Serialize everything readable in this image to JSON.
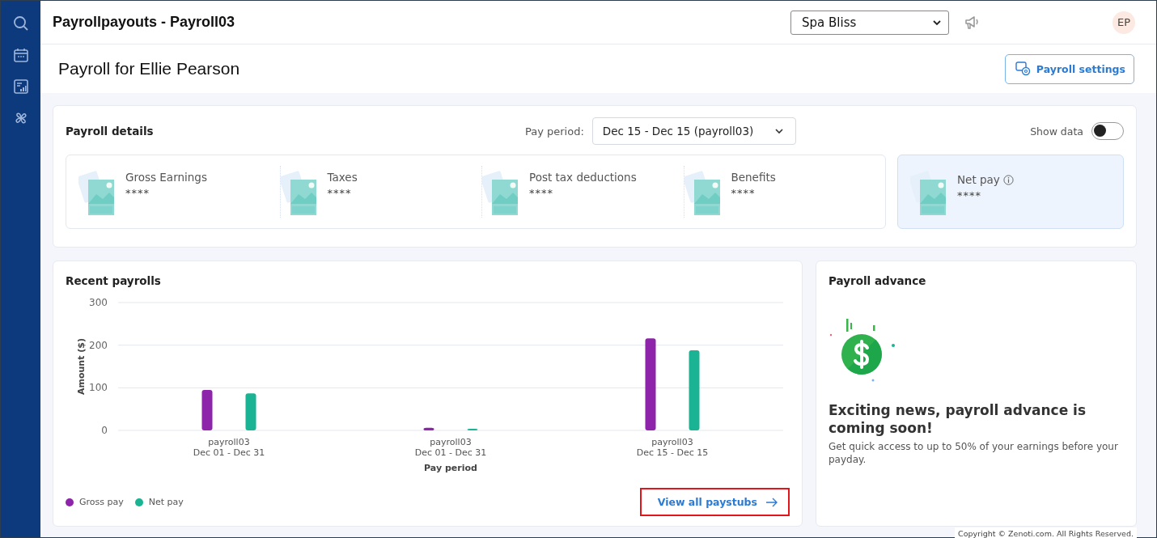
{
  "header": {
    "title": "Payrollpayouts - Payroll03",
    "location": {
      "value": "Spa Bliss"
    },
    "avatar": "EP"
  },
  "page": {
    "title": "Payroll for Ellie Pearson",
    "settings_button": "Payroll settings"
  },
  "details": {
    "title": "Payroll details",
    "pay_period_label": "Pay period:",
    "pay_period": "Dec 15 - Dec 15 (payroll03)",
    "show_data": {
      "label": "Show data",
      "on": false
    },
    "items": [
      {
        "label": "Gross Earnings",
        "value": "****"
      },
      {
        "label": "Taxes",
        "value": "****"
      },
      {
        "label": "Post tax deductions",
        "value": "****"
      },
      {
        "label": "Benefits",
        "value": "****"
      }
    ],
    "net_pay": {
      "label": "Net pay",
      "value": "****"
    }
  },
  "recent": {
    "title": "Recent payrolls",
    "link": "View all paystubs",
    "chart_data": {
      "type": "bar",
      "xlabel": "Pay period",
      "ylabel": "Amount ($)",
      "categories": [
        "payroll03\nDec 01 - Dec 31",
        "payroll03\nDec 01 - Dec 31",
        "payroll03\nDec 15 - Dec 15"
      ],
      "ylim": [
        0,
        300
      ],
      "yticks": [
        0,
        100,
        200,
        300
      ],
      "series": [
        {
          "name": "Gross pay",
          "color": "#8e24aa",
          "values": [
            95,
            6,
            216
          ]
        },
        {
          "name": "Net pay",
          "color": "#1ab394",
          "values": [
            87,
            4,
            188
          ]
        }
      ]
    }
  },
  "advance": {
    "title": "Payroll advance",
    "headline": "Exciting news, payroll advance is coming soon!",
    "text": "Get quick access to up to 50% of your earnings before your payday."
  },
  "footer": "Copyright © Zenoti.com. All Rights Reserved."
}
